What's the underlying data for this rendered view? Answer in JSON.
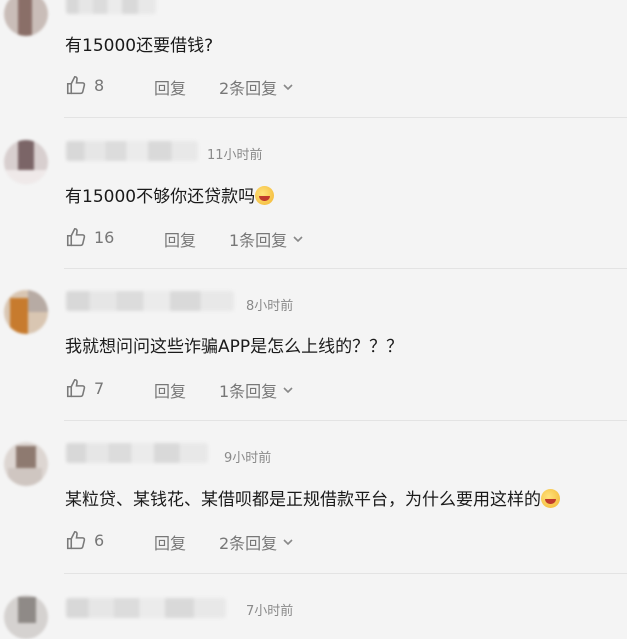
{
  "comments": [
    {
      "time": "",
      "content": "有15000还要借钱?",
      "emoji": false,
      "likes": "8",
      "reply_label": "回复",
      "replies_label": "2条回复"
    },
    {
      "time": "11小时前",
      "content": "有15000不够你还贷款吗",
      "emoji": true,
      "likes": "16",
      "reply_label": "回复",
      "replies_label": "1条回复"
    },
    {
      "time": "8小时前",
      "content": "我就想问问这些诈骗APP是怎么上线的？？？",
      "emoji": false,
      "likes": "7",
      "reply_label": "回复",
      "replies_label": "1条回复"
    },
    {
      "time": "9小时前",
      "content": "某粒贷、某钱花、某借呗都是正规借款平台，为什么要用这样的",
      "emoji": true,
      "likes": "6",
      "reply_label": "回复",
      "replies_label": "2条回复"
    },
    {
      "time": "7小时前"
    }
  ],
  "icons": {
    "like": "thumbs-up-icon",
    "expand": "chevron-down-icon",
    "emoji_face": "laughing-face-icon"
  }
}
